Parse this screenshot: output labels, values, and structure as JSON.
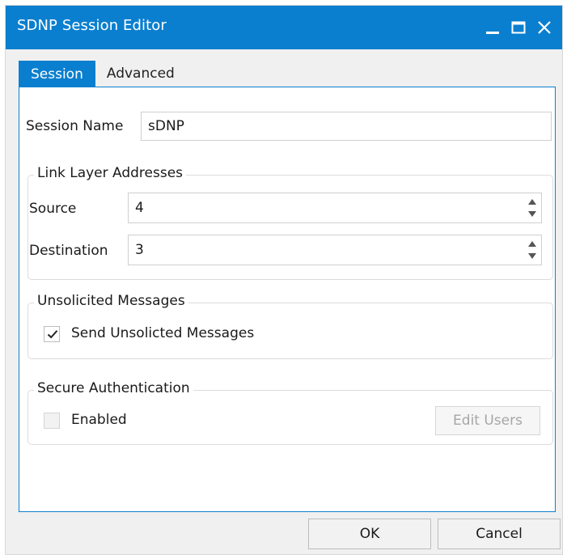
{
  "window": {
    "title": "SDNP Session Editor",
    "accent_color": "#0b7fcf",
    "controls": [
      "minimize-icon",
      "maximize-icon",
      "close-icon"
    ]
  },
  "tabs": [
    {
      "label": "Session",
      "active": true
    },
    {
      "label": "Advanced",
      "active": false
    }
  ],
  "session": {
    "name_label": "Session Name",
    "name_value": "sDNP"
  },
  "link_layer": {
    "title": "Link Layer Addresses",
    "source_label": "Source",
    "source_value": "4",
    "destination_label": "Destination",
    "destination_value": "3"
  },
  "unsolicited": {
    "title": "Unsolicited Messages",
    "send_label": "Send Unsolicted Messages",
    "send_checked": true
  },
  "secure_auth": {
    "title": "Secure Authentication",
    "enabled_label": "Enabled",
    "enabled_checked": false,
    "edit_users_label": "Edit Users"
  },
  "footer": {
    "ok_label": "OK",
    "cancel_label": "Cancel"
  }
}
